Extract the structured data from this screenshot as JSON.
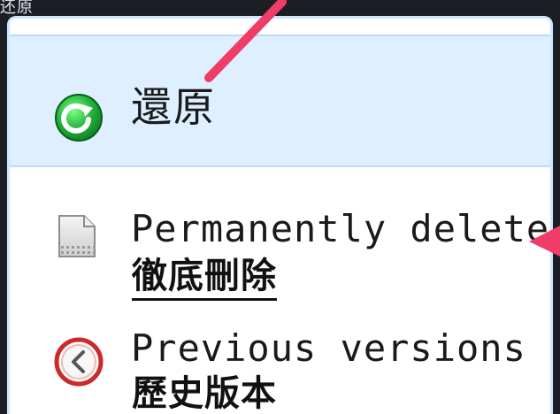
{
  "window": {
    "top_title": "还原"
  },
  "menu": {
    "items": [
      {
        "icon": "restore-icon",
        "label": "還原"
      },
      {
        "icon": "delete-icon",
        "label": "Permanently delete",
        "sub_label": "徹底刪除"
      },
      {
        "icon": "previous-versions-icon",
        "label": "Previous versions",
        "sub_label": "歷史版本"
      }
    ]
  },
  "colors": {
    "menu_background": "#ffffff",
    "highlight_background": "#deefff",
    "border": "#cfe6ff",
    "arrow": "#ef3d67"
  }
}
